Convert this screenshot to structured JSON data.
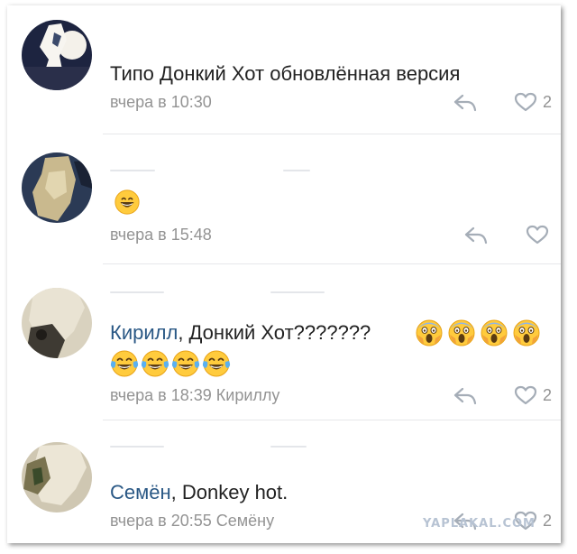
{
  "comments": [
    {
      "text": "Типо Донкий Хот обновлённая версия",
      "time": "вчера в 10:30",
      "likes": "2"
    },
    {
      "text": "",
      "time": "вчера в 15:48",
      "likes": ""
    },
    {
      "mention": "Кирилл",
      "text": ", Донкий Хот???????",
      "time": "вчера в 18:39 Кириллу",
      "likes": "2"
    },
    {
      "mention": "Семён",
      "text": ", Donkey hot.",
      "time": "вчера в 20:55 Семёну",
      "likes": "2"
    }
  ],
  "icons": {
    "reply": "reply-arrow-icon",
    "like": "heart-outline-icon",
    "emoji_grin": "grinning-face-icon",
    "emoji_scream": "face-screaming-in-fear-icon",
    "emoji_joy": "face-with-tears-of-joy-icon"
  },
  "colors": {
    "mention": "#2a5885",
    "meta": "#939393",
    "text": "#222222",
    "emoji_yellow": "#ffcb3d"
  },
  "watermark": "YAPLAKAL.COM"
}
